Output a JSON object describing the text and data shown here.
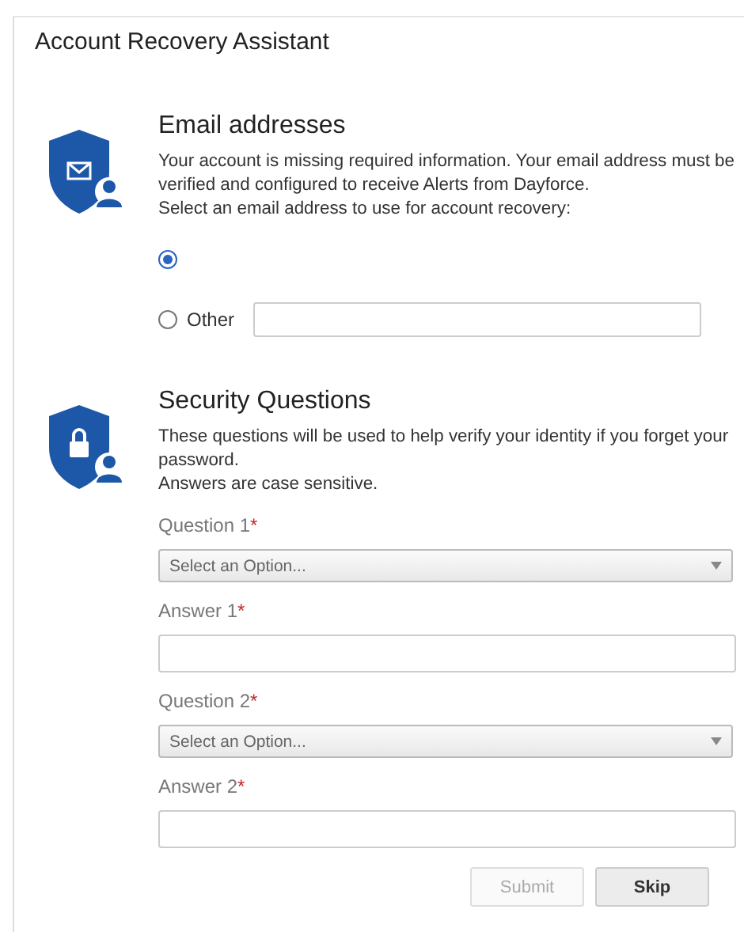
{
  "title": "Account Recovery Assistant",
  "email_section": {
    "heading": "Email addresses",
    "paragraphs": [
      "Your account is missing required information. Your email address must be verified and configured to receive Alerts from Dayforce.",
      "Select an email address to use for account recovery:"
    ],
    "options": [
      {
        "kind": "address",
        "selected": true
      },
      {
        "kind": "other",
        "label": "Other",
        "selected": false
      }
    ]
  },
  "security_section": {
    "heading": "Security Questions",
    "paragraphs": [
      "These questions will be used to help verify your identity if you forget your password.",
      "Answers are case sensitive."
    ],
    "fields": [
      {
        "kind": "select",
        "label": "Question 1",
        "required": "*",
        "placeholder": "Select an Option..."
      },
      {
        "kind": "text",
        "label": "Answer 1",
        "required": "*"
      },
      {
        "kind": "select",
        "label": "Question 2",
        "required": "*",
        "placeholder": "Select an Option..."
      },
      {
        "kind": "text",
        "label": "Answer 2",
        "required": "*"
      }
    ]
  },
  "buttons": [
    {
      "label": "Submit",
      "disabled": true
    },
    {
      "label": "Skip",
      "disabled": false
    }
  ]
}
